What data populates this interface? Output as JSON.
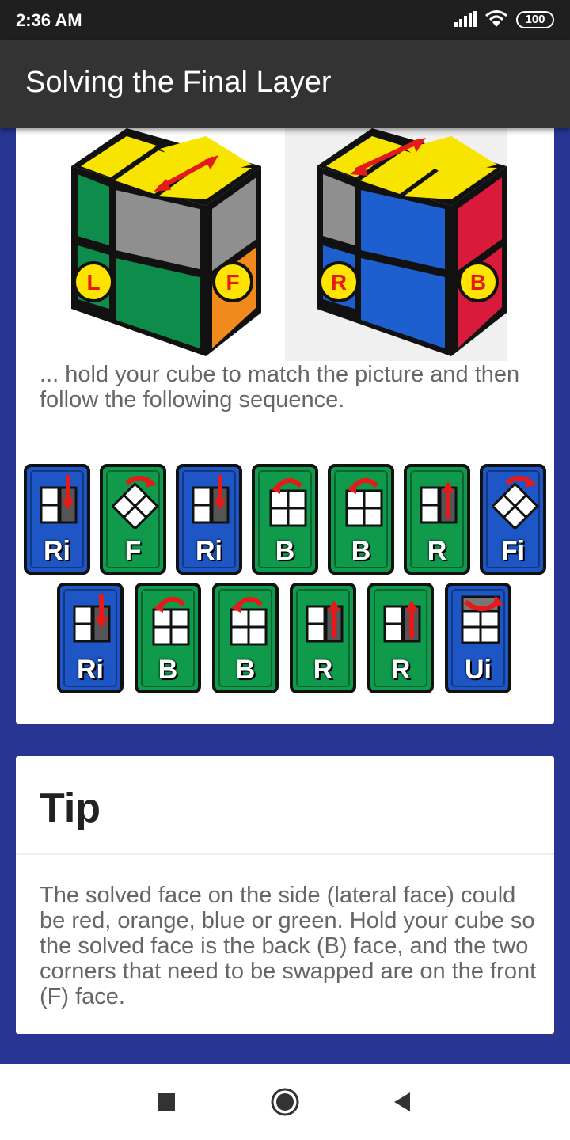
{
  "status_bar": {
    "time": "2:36 AM",
    "battery": "100",
    "icons": [
      "signal-icon",
      "wifi-icon",
      "battery-icon"
    ]
  },
  "app_bar": {
    "title": "Solving the Final Layer"
  },
  "cube_illustration": {
    "icon": "cube-orientation-illustration",
    "face_badges": [
      "L",
      "F",
      "R",
      "B"
    ]
  },
  "instruction": {
    "text": "... hold your cube to match the picture and then follow the following sequence."
  },
  "sequence": {
    "moves": [
      {
        "label": "Ri",
        "color": "blue",
        "type": "down"
      },
      {
        "label": "F",
        "color": "green",
        "type": "face"
      },
      {
        "label": "Ri",
        "color": "blue",
        "type": "down"
      },
      {
        "label": "B",
        "color": "green",
        "type": "back"
      },
      {
        "label": "B",
        "color": "green",
        "type": "back"
      },
      {
        "label": "R",
        "color": "green",
        "type": "up"
      },
      {
        "label": "Fi",
        "color": "blue",
        "type": "face"
      },
      {
        "label": "Ri",
        "color": "blue",
        "type": "down"
      },
      {
        "label": "B",
        "color": "green",
        "type": "back"
      },
      {
        "label": "B",
        "color": "green",
        "type": "back"
      },
      {
        "label": "R",
        "color": "green",
        "type": "up"
      },
      {
        "label": "R",
        "color": "green",
        "type": "up"
      },
      {
        "label": "Ui",
        "color": "blue",
        "type": "top"
      }
    ]
  },
  "tip": {
    "title": "Tip",
    "text": "The solved face on the side (lateral face) could be red, orange, blue or green. Hold your cube so the solved face is the back (B) face, and the two corners that need to be swapped are on the front (F) face."
  },
  "nav_bar": {
    "icons": [
      "recents-square-icon",
      "home-circle-icon",
      "back-triangle-icon"
    ]
  },
  "colors": {
    "background": "#283593",
    "app_bar": "#333333",
    "status_bar": "#1f1f1f",
    "move_blue": "#1e56c6",
    "move_green": "#0f9a4c"
  }
}
